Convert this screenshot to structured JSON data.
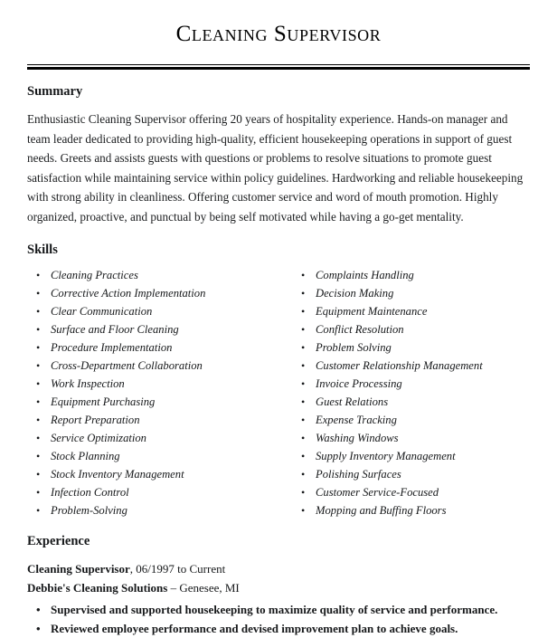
{
  "document": {
    "title": "Cleaning Supervisor"
  },
  "summary": {
    "heading": "Summary",
    "text": "Enthusiastic Cleaning Supervisor offering 20 years of hospitality experience. Hands-on manager and team leader dedicated to providing high-quality, efficient housekeeping operations in support of guest needs. Greets and assists guests with questions or problems to resolve situations to promote guest satisfaction while maintaining service within policy guidelines. Hardworking and reliable housekeeping with strong ability in cleanliness. Offering customer service and word of mouth promotion. Highly organized, proactive, and punctual by being self motivated while having a go-get mentality."
  },
  "skills": {
    "heading": "Skills",
    "left_column": [
      "Cleaning Practices",
      "Corrective Action Implementation",
      "Clear Communication",
      "Surface and Floor Cleaning",
      "Procedure Implementation",
      "Cross-Department Collaboration",
      "Work Inspection",
      "Equipment Purchasing",
      "Report Preparation",
      "Service Optimization",
      "Stock Planning",
      "Stock Inventory Management",
      "Infection Control",
      "Problem-Solving"
    ],
    "right_column": [
      "Complaints Handling",
      "Decision Making",
      "Equipment Maintenance",
      "Conflict Resolution",
      "Problem Solving",
      "Customer Relationship Management",
      "Invoice Processing",
      "Guest Relations",
      "Expense Tracking",
      "Washing Windows",
      "Supply Inventory Management",
      "Polishing Surfaces",
      "Customer Service-Focused",
      "Mopping and Buffing Floors"
    ]
  },
  "experience": {
    "heading": "Experience",
    "jobs": [
      {
        "job_title": "Cleaning Supervisor",
        "dates": ", 06/1997 to Current",
        "company": "Debbie's Cleaning Solutions",
        "location": " – Genesee, MI",
        "duties": [
          "Supervised and supported housekeeping to maximize quality of service and performance.",
          "Reviewed employee performance and devised improvement plan to achieve goals."
        ]
      }
    ]
  }
}
